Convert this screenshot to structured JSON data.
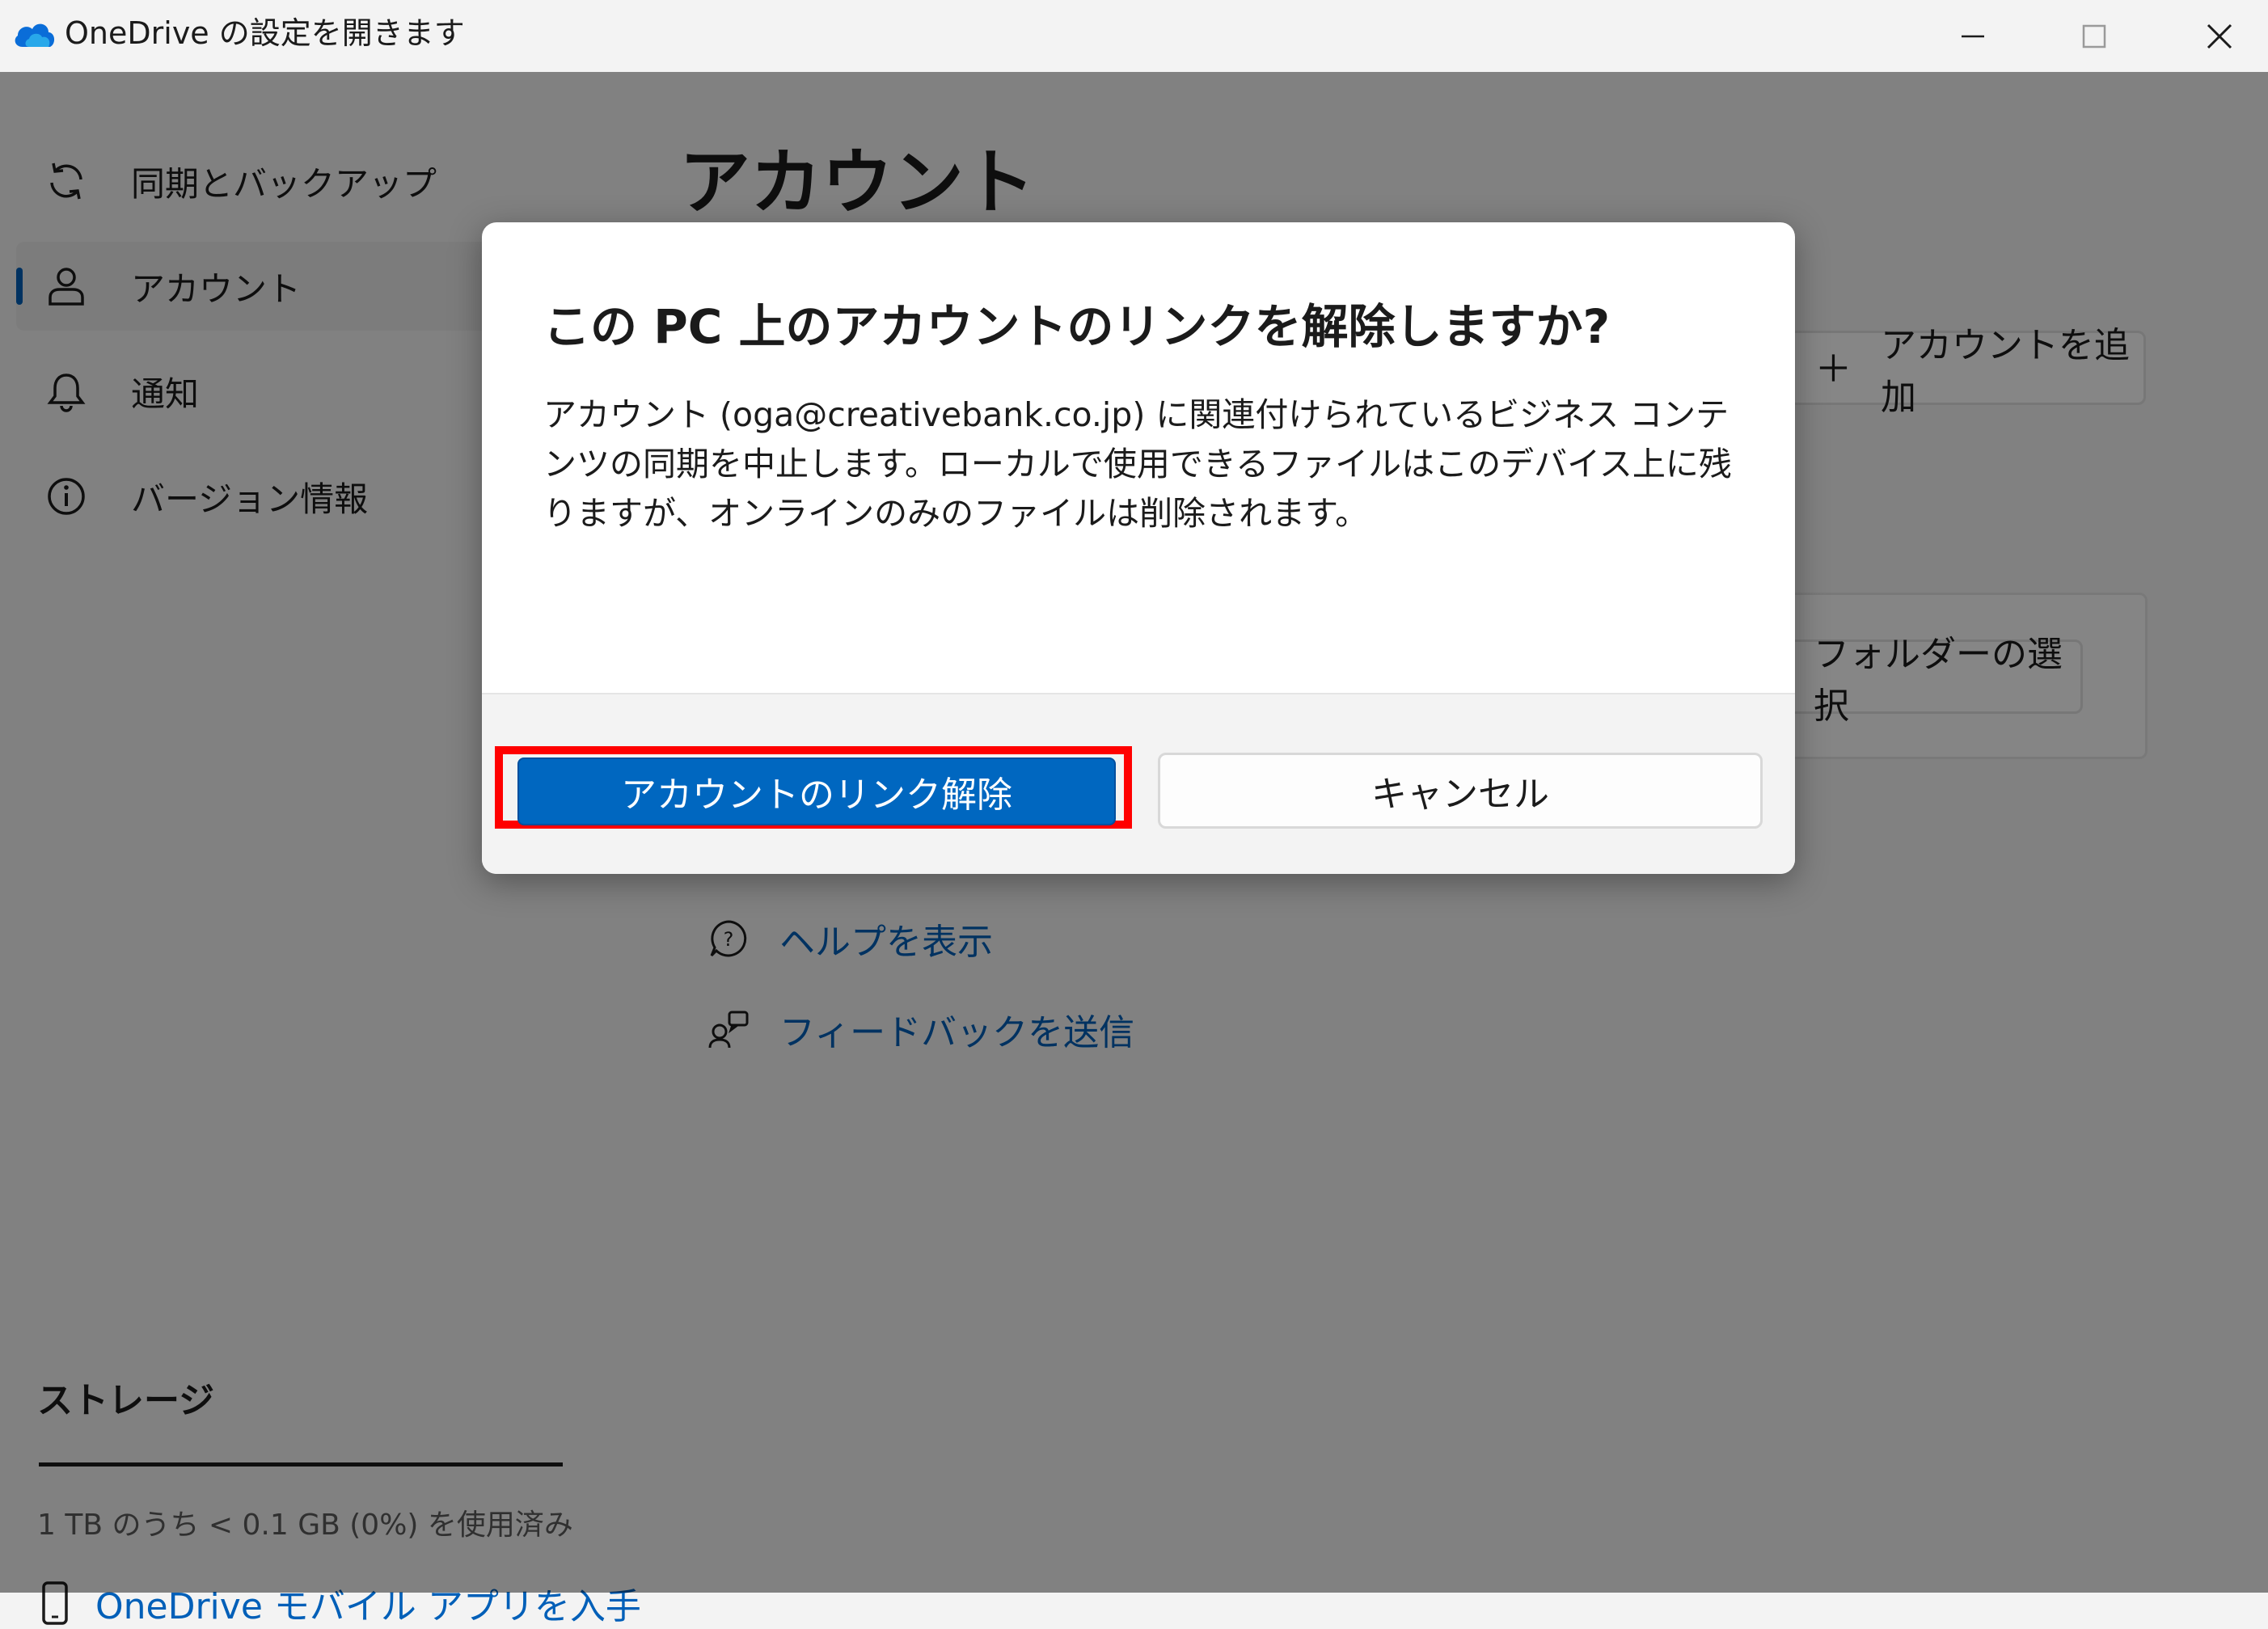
{
  "window": {
    "title": "OneDrive の設定を開きます",
    "app_icon": "onedrive-cloud-icon",
    "controls": [
      "minimize-icon",
      "maximize-icon",
      "close-icon"
    ]
  },
  "sidebar": {
    "items": [
      {
        "label": "同期とバックアップ",
        "icon": "sync-icon",
        "selected": false
      },
      {
        "label": "アカウント",
        "icon": "person-icon",
        "selected": true
      },
      {
        "label": "通知",
        "icon": "bell-icon",
        "selected": false
      },
      {
        "label": "バージョン情報",
        "icon": "info-icon",
        "selected": false
      }
    ]
  },
  "main": {
    "title": "アカウント",
    "add_account_label": "アカウントを追加",
    "choose_folders_label": "フォルダーの選択",
    "help_label": "ヘルプを表示",
    "feedback_label": "フィードバックを送信"
  },
  "storage": {
    "title": "ストレージ",
    "usage_text": "1 TB のうち < 0.1 GB (0%) を使用済み",
    "usage_fraction": 0.0,
    "mobile_app_label": "OneDrive モバイル アプリを入手"
  },
  "dialog": {
    "title": "この PC 上のアカウントのリンクを解除しますか?",
    "body": "アカウント (oga@creativebank.co.jp) に関連付けられているビジネス コンテンツの同期を中止します。ローカルで使用できるファイルはこのデバイス上に残りますが、オンラインのみのファイルは削除されます。",
    "primary_button": "アカウントのリンク解除",
    "secondary_button": "キャンセル"
  },
  "colors": {
    "accent": "#0067c0",
    "link": "#005fb8",
    "highlight": "#ff0000",
    "overlay": "rgba(0,0,0,0.47)"
  }
}
